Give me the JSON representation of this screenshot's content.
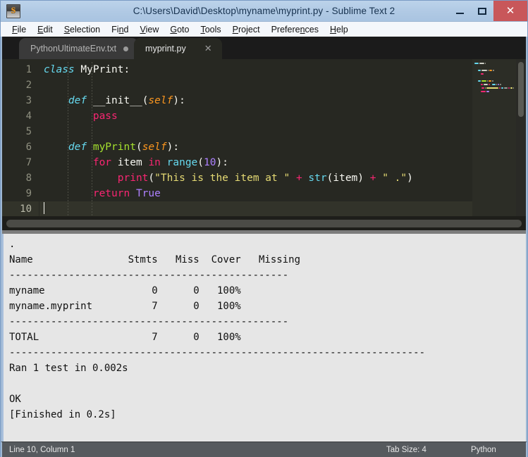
{
  "window": {
    "title": "C:\\Users\\David\\Desktop\\myname\\myprint.py - Sublime Text 2",
    "app_icon": "S",
    "controls": {
      "minimize": "minimize-icon",
      "maximize": "maximize-icon",
      "close": "✕"
    },
    "accent_close": "#c8575a",
    "titlebar_color": "#b0c9e4"
  },
  "menubar": {
    "items": [
      {
        "pre": "",
        "mnemonic": "F",
        "post": "ile"
      },
      {
        "pre": "",
        "mnemonic": "E",
        "post": "dit"
      },
      {
        "pre": "",
        "mnemonic": "S",
        "post": "election"
      },
      {
        "pre": "Fi",
        "mnemonic": "n",
        "post": "d"
      },
      {
        "pre": "",
        "mnemonic": "V",
        "post": "iew"
      },
      {
        "pre": "",
        "mnemonic": "G",
        "post": "oto"
      },
      {
        "pre": "",
        "mnemonic": "T",
        "post": "ools"
      },
      {
        "pre": "",
        "mnemonic": "P",
        "post": "roject"
      },
      {
        "pre": "Prefere",
        "mnemonic": "n",
        "post": "ces"
      },
      {
        "pre": "",
        "mnemonic": "H",
        "post": "elp"
      }
    ]
  },
  "tabs": [
    {
      "label": "PythonUltimateEnv.txt",
      "active": false,
      "dirty": true
    },
    {
      "label": "myprint.py",
      "active": true,
      "dirty": false,
      "close": "✕"
    }
  ],
  "editor": {
    "gutter": [
      "1",
      "2",
      "3",
      "4",
      "5",
      "6",
      "7",
      "8",
      "9",
      "10"
    ],
    "current_line": 10,
    "lines": [
      {
        "n": 1,
        "tokens": [
          {
            "t": "class ",
            "c": "k-kw"
          },
          {
            "t": "MyPrint",
            "c": "k-name"
          },
          {
            "t": ":",
            "c": "k-punct"
          }
        ]
      },
      {
        "n": 2,
        "tokens": []
      },
      {
        "n": 3,
        "tokens": [
          {
            "t": "    ",
            "c": "k-punct"
          },
          {
            "t": "def ",
            "c": "k-kw"
          },
          {
            "t": "__init__",
            "c": "k-name"
          },
          {
            "t": "(",
            "c": "k-punct"
          },
          {
            "t": "self",
            "c": "k-param"
          },
          {
            "t": "):",
            "c": "k-punct"
          }
        ]
      },
      {
        "n": 4,
        "tokens": [
          {
            "t": "        ",
            "c": "k-punct"
          },
          {
            "t": "pass",
            "c": "k-ctrl"
          }
        ]
      },
      {
        "n": 5,
        "tokens": []
      },
      {
        "n": 6,
        "tokens": [
          {
            "t": "    ",
            "c": "k-punct"
          },
          {
            "t": "def ",
            "c": "k-kw"
          },
          {
            "t": "myPrint",
            "c": "k-fn"
          },
          {
            "t": "(",
            "c": "k-punct"
          },
          {
            "t": "self",
            "c": "k-param"
          },
          {
            "t": "):",
            "c": "k-punct"
          }
        ]
      },
      {
        "n": 7,
        "tokens": [
          {
            "t": "        ",
            "c": "k-punct"
          },
          {
            "t": "for",
            "c": "k-ctrl"
          },
          {
            "t": " item ",
            "c": "k-name"
          },
          {
            "t": "in",
            "c": "k-ctrl"
          },
          {
            "t": " ",
            "c": "k-punct"
          },
          {
            "t": "range",
            "c": "k-builtin"
          },
          {
            "t": "(",
            "c": "k-punct"
          },
          {
            "t": "10",
            "c": "k-num"
          },
          {
            "t": "):",
            "c": "k-punct"
          }
        ]
      },
      {
        "n": 8,
        "tokens": [
          {
            "t": "            ",
            "c": "k-punct"
          },
          {
            "t": "print",
            "c": "k-ctrl"
          },
          {
            "t": "(",
            "c": "k-punct"
          },
          {
            "t": "\"This is the item at \"",
            "c": "k-str"
          },
          {
            "t": " + ",
            "c": "k-op"
          },
          {
            "t": "str",
            "c": "k-builtin"
          },
          {
            "t": "(item)",
            "c": "k-punct"
          },
          {
            "t": " + ",
            "c": "k-op"
          },
          {
            "t": "\" .\"",
            "c": "k-str"
          },
          {
            "t": ")",
            "c": "k-punct"
          }
        ]
      },
      {
        "n": 9,
        "tokens": [
          {
            "t": "        ",
            "c": "k-punct"
          },
          {
            "t": "return ",
            "c": "k-ctrl"
          },
          {
            "t": "True",
            "c": "k-const"
          }
        ]
      },
      {
        "n": 10,
        "tokens": []
      }
    ]
  },
  "console": {
    "lines": [
      ".",
      "Name                Stmts   Miss  Cover   Missing",
      "-----------------------------------------------",
      "myname                  0      0   100%",
      "myname.myprint          7      0   100%",
      "-----------------------------------------------",
      "TOTAL                   7      0   100%",
      "----------------------------------------------------------------------",
      "Ran 1 test in 0.002s",
      "",
      "OK",
      "[Finished in 0.2s]"
    ]
  },
  "statusbar": {
    "position": "Line 10, Column 1",
    "tab_size": "Tab Size: 4",
    "syntax": "Python"
  }
}
